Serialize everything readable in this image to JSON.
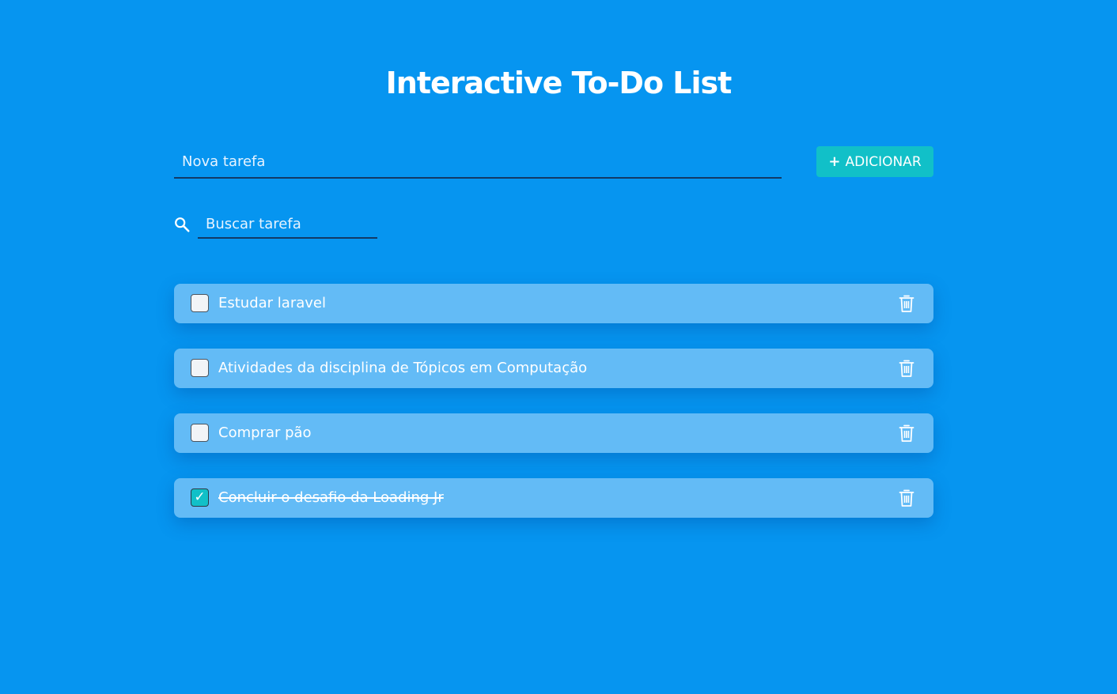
{
  "header": {
    "title": "Interactive To-Do List"
  },
  "new_task": {
    "placeholder": "Nova tarefa",
    "value": "",
    "add_label": "ADICIONAR",
    "add_icon": "plus-icon"
  },
  "search": {
    "placeholder": "Buscar tarefa",
    "value": "",
    "icon": "search-icon"
  },
  "tasks": [
    {
      "text": "Estudar laravel",
      "completed": false
    },
    {
      "text": "Atividades da disciplina de Tópicos em Computação",
      "completed": false
    },
    {
      "text": "Comprar pão",
      "completed": false
    },
    {
      "text": "Concluir o desafio da Loading Jr",
      "completed": true
    }
  ],
  "colors": {
    "background": "#0695f0",
    "accent": "#11c0c8",
    "task_background": "#63bbf6",
    "text": "#ffffff"
  }
}
